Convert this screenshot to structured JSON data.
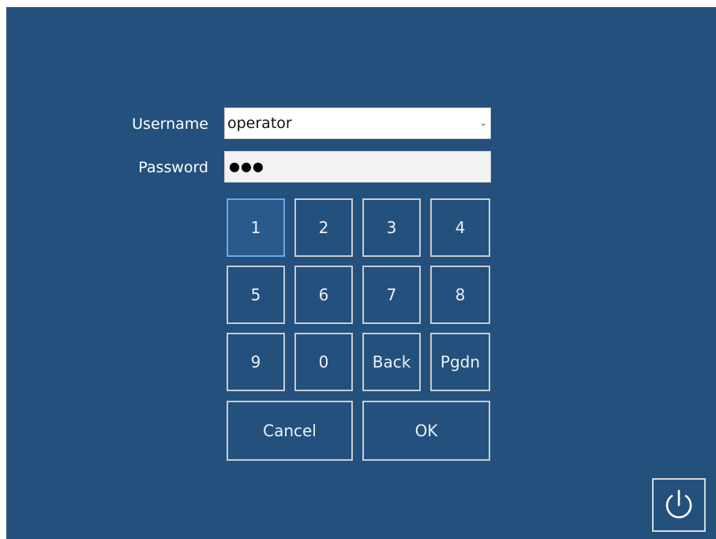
{
  "login": {
    "username_label": "Username",
    "password_label": "Password",
    "username_value": "operator",
    "password_mask": "●●●",
    "dropdown_icon": "chevron-down-icon"
  },
  "keypad": {
    "k1": "1",
    "k2": "2",
    "k3": "3",
    "k4": "4",
    "k5": "5",
    "k6": "6",
    "k7": "7",
    "k8": "8",
    "k9": "9",
    "k0": "0",
    "back": "Back",
    "pgdn": "Pgdn",
    "cancel": "Cancel",
    "ok": "OK"
  },
  "power": {
    "icon": "power-icon"
  },
  "colors": {
    "background": "#24507e",
    "key_border": "#c8ccd2",
    "focus_border": "#6aa8e0"
  }
}
